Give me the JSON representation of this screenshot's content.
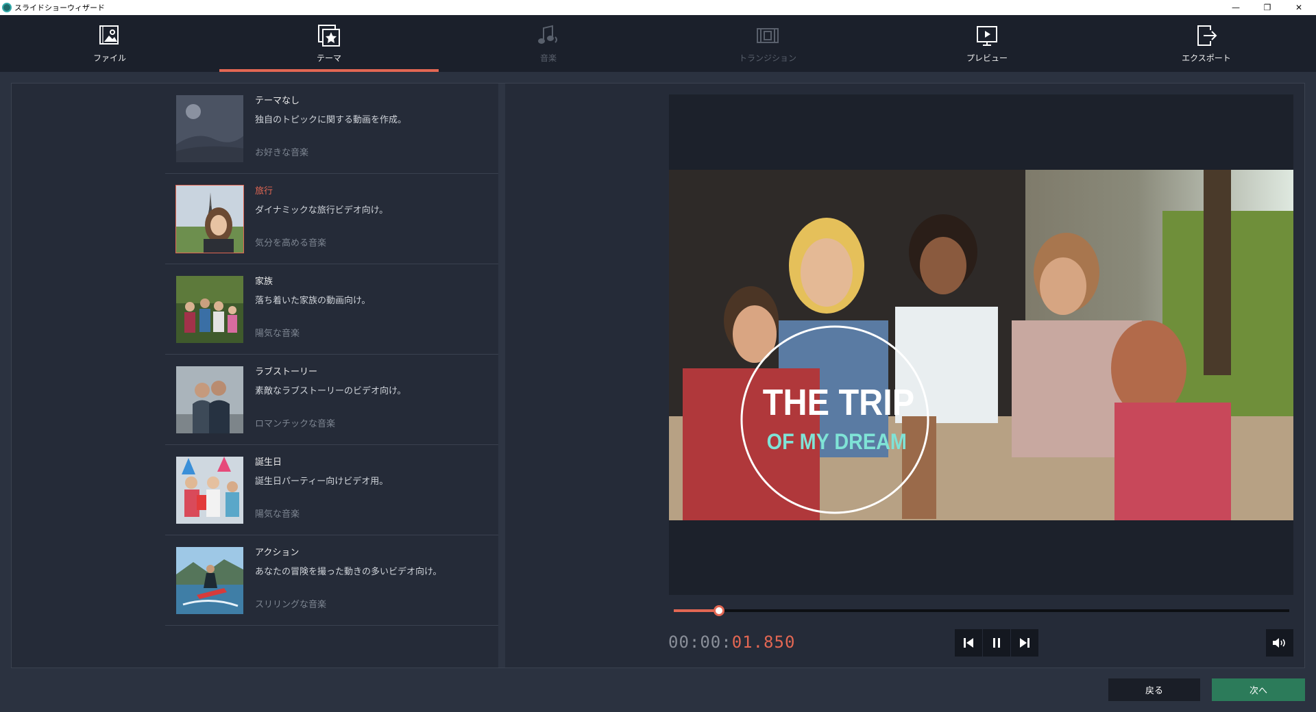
{
  "window": {
    "title": "スライドショーウィザード",
    "controls": {
      "minimize": "—",
      "restore": "❐",
      "close": "✕"
    }
  },
  "nav": {
    "tabs": [
      {
        "label": "ファイル",
        "icon": "file-image-icon"
      },
      {
        "label": "テーマ",
        "icon": "theme-star-icon"
      },
      {
        "label": "音楽",
        "icon": "music-note-icon"
      },
      {
        "label": "トランジション",
        "icon": "transition-icon"
      },
      {
        "label": "プレビュー",
        "icon": "preview-play-icon"
      },
      {
        "label": "エクスポート",
        "icon": "export-icon"
      }
    ],
    "active": "テーマ"
  },
  "themes": [
    {
      "title": "テーマなし",
      "desc": "独自のトピックに関する動画を作成。",
      "music": "お好きな音楽",
      "selected": false
    },
    {
      "title": "旅行",
      "desc": "ダイナミックな旅行ビデオ向け。",
      "music": "気分を高める音楽",
      "selected": true
    },
    {
      "title": "家族",
      "desc": "落ち着いた家族の動画向け。",
      "music": "陽気な音楽",
      "selected": false
    },
    {
      "title": "ラブストーリー",
      "desc": "素敵なラブストーリーのビデオ向け。",
      "music": "ロマンチックな音楽",
      "selected": false
    },
    {
      "title": "誕生日",
      "desc": "誕生日パーティー向けビデオ用。",
      "music": "陽気な音楽",
      "selected": false
    },
    {
      "title": "アクション",
      "desc": "あなたの冒険を撮った動きの多いビデオ向け。",
      "music": "スリリングな音楽",
      "selected": false
    }
  ],
  "preview": {
    "overlay_line1": "THE TRIP",
    "overlay_line2": "OF MY DREAM",
    "progress": 0.073,
    "timecode_dim": "00:00:",
    "timecode_hi": "01.850"
  },
  "footer": {
    "back_label": "戻る",
    "next_label": "次へ"
  },
  "colors": {
    "accent": "#e36753",
    "next_button": "#2c7b5a",
    "background": "#2b3240"
  }
}
